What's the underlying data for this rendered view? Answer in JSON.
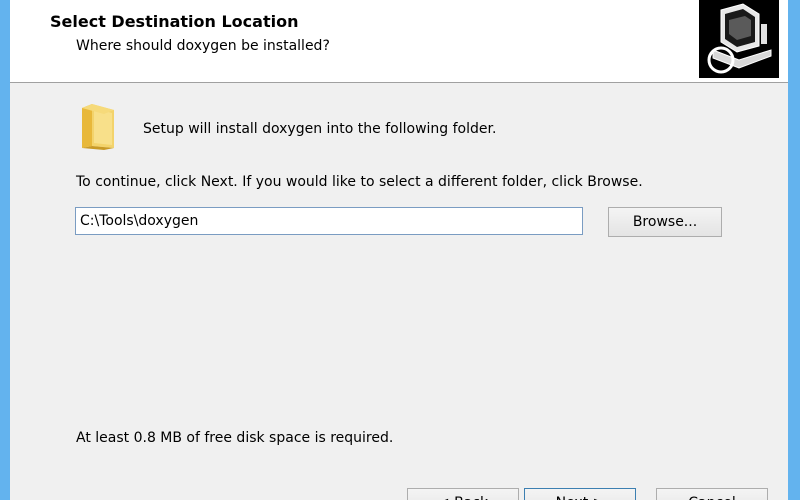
{
  "header": {
    "title": "Select Destination Location",
    "subtitle": "Where should doxygen be installed?",
    "image_icon": "computer-install-icon"
  },
  "main": {
    "folder_icon": "folder-icon",
    "install_text": "Setup will install doxygen into the following folder.",
    "continue_text": "To continue, click Next. If you would like to select a different folder, click Browse.",
    "path_value": "C:\\Tools\\doxygen",
    "browse_label": "Browse...",
    "disk_space_text": "At least 0.8 MB of free disk space is required."
  },
  "buttons": {
    "back_label": "< Back",
    "next_label": "Next >",
    "cancel_label": "Cancel"
  }
}
